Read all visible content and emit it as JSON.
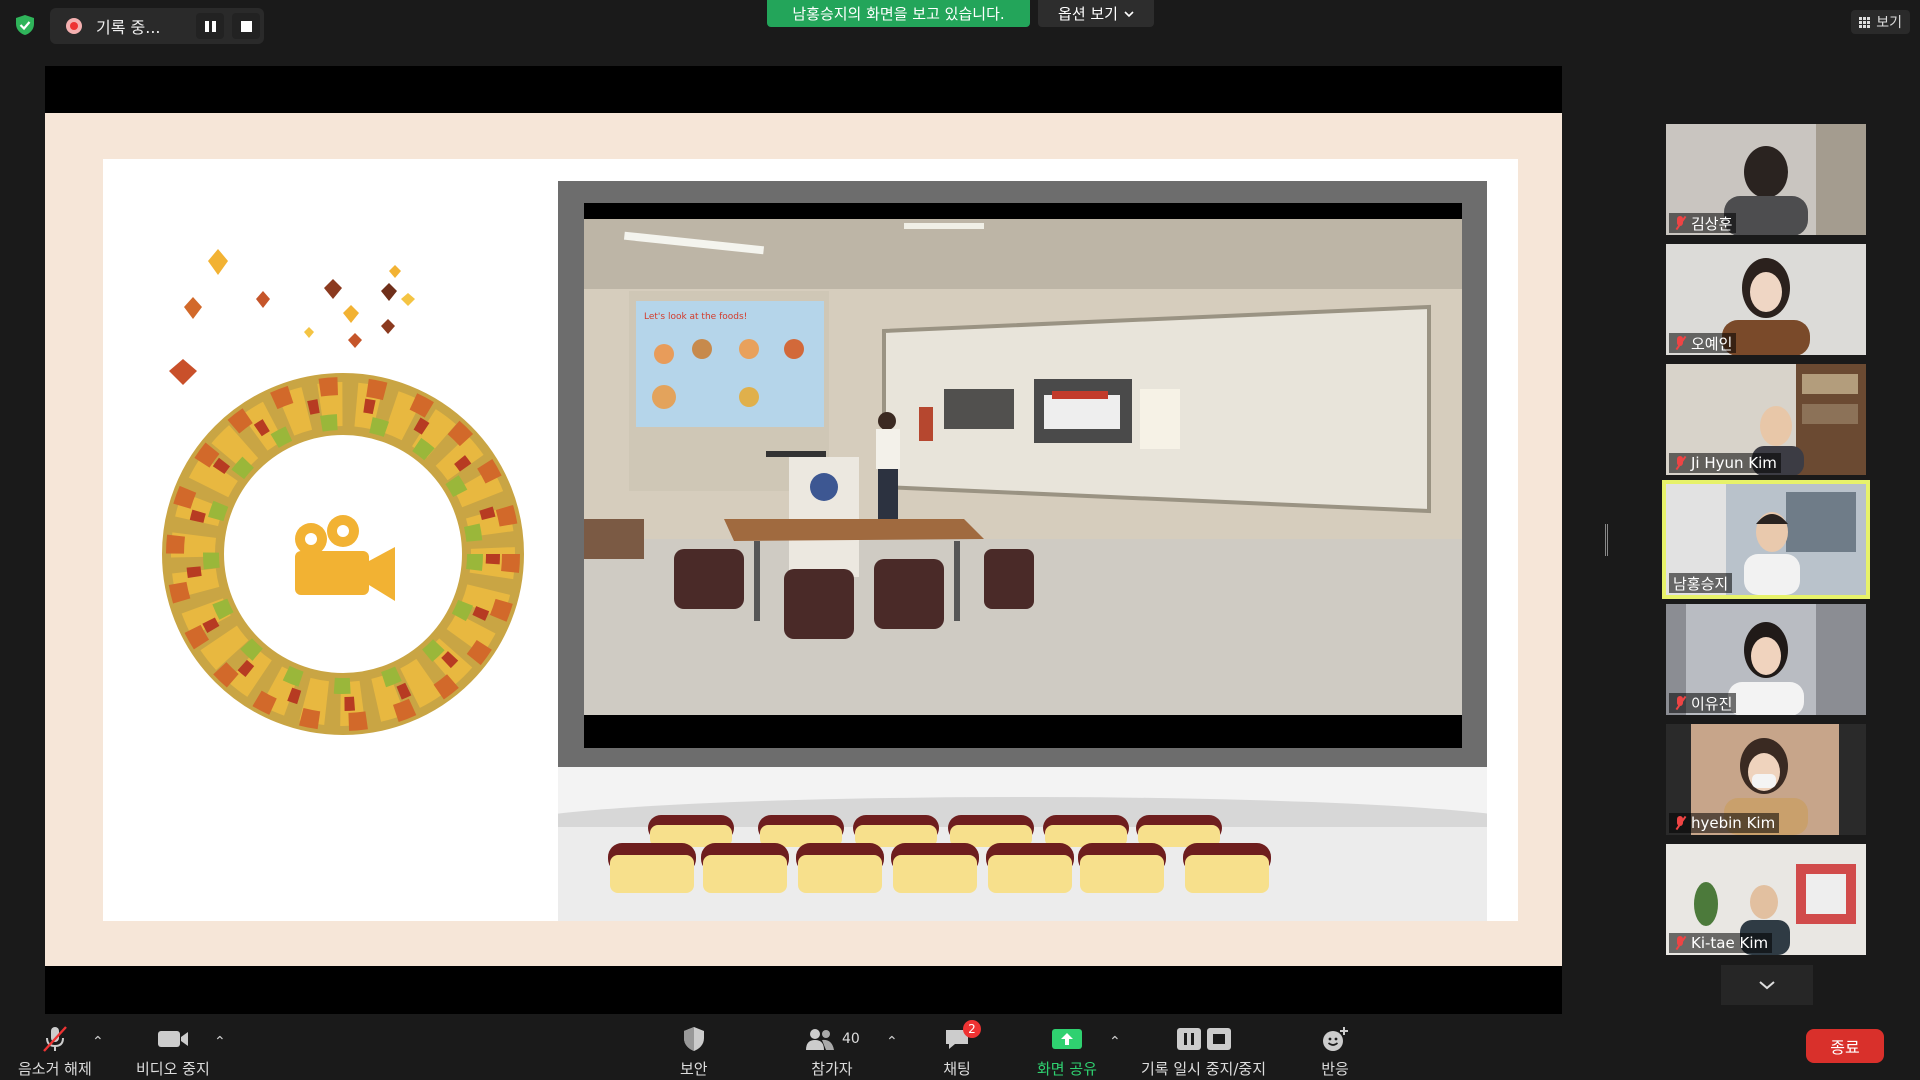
{
  "top": {
    "recording_label": "기록 중...",
    "viewing_banner": "남홍승지의 화면을 보고 있습니다.",
    "view_options": "옵션 보기",
    "view_button": "보기"
  },
  "slide_video": {
    "projector_text": "Let's look at the foods!"
  },
  "participants": [
    {
      "name": "김상훈",
      "muted": true,
      "active": false
    },
    {
      "name": "오예인",
      "muted": true,
      "active": false
    },
    {
      "name": "Ji Hyun Kim",
      "muted": true,
      "active": false
    },
    {
      "name": "남홍승지",
      "muted": false,
      "active": true
    },
    {
      "name": "이유진",
      "muted": true,
      "active": false
    },
    {
      "name": "hyebin Kim",
      "muted": true,
      "active": false
    },
    {
      "name": "Ki-tae Kim",
      "muted": true,
      "active": false
    }
  ],
  "toolbar": {
    "unmute": "음소거 해제",
    "stop_video": "비디오 중지",
    "security": "보안",
    "participants": "참가자",
    "participants_count": "40",
    "chat": "채팅",
    "chat_badge": "2",
    "share_screen": "화면 공유",
    "pause_stop_recording": "기록 일시 중지/중지",
    "reactions": "반응",
    "end": "종료"
  },
  "colors": {
    "banner_green": "#23a55a",
    "active_speaker_outline": "#e7f26a",
    "end_red": "#d9302b",
    "share_label_green": "#2fd170"
  }
}
